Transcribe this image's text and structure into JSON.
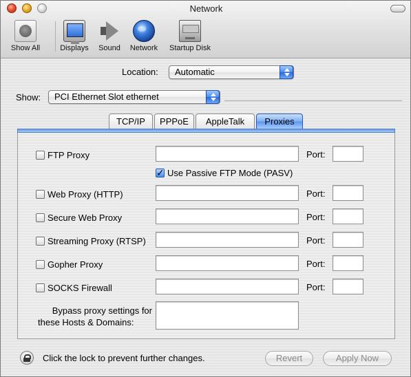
{
  "window": {
    "title": "Network"
  },
  "toolbar": {
    "show_all": "Show All",
    "items": [
      {
        "label": "Displays",
        "icon": "displays-icon"
      },
      {
        "label": "Sound",
        "icon": "speaker-icon"
      },
      {
        "label": "Network",
        "icon": "globe-icon"
      },
      {
        "label": "Startup Disk",
        "icon": "hard-disk-icon"
      }
    ]
  },
  "location": {
    "label": "Location:",
    "value": "Automatic"
  },
  "show": {
    "label": "Show:",
    "value": "PCI Ethernet Slot ethernet"
  },
  "tabs": [
    {
      "label": "TCP/IP",
      "active": false
    },
    {
      "label": "PPPoE",
      "active": false
    },
    {
      "label": "AppleTalk",
      "active": false
    },
    {
      "label": "Proxies",
      "active": true
    }
  ],
  "proxies": {
    "port_label": "Port:",
    "ftp": {
      "label": "FTP Proxy",
      "checked": false,
      "server": "",
      "port": ""
    },
    "passive_ftp": {
      "label": "Use Passive FTP Mode (PASV)",
      "checked": true
    },
    "web": {
      "label": "Web Proxy (HTTP)",
      "checked": false,
      "server": "",
      "port": ""
    },
    "secure_web": {
      "label": "Secure Web Proxy",
      "checked": false,
      "server": "",
      "port": ""
    },
    "streaming": {
      "label": "Streaming Proxy (RTSP)",
      "checked": false,
      "server": "",
      "port": ""
    },
    "gopher": {
      "label": "Gopher Proxy",
      "checked": false,
      "server": "",
      "port": ""
    },
    "socks": {
      "label": "SOCKS Firewall",
      "checked": false,
      "server": "",
      "port": ""
    },
    "bypass": {
      "label_line1": "Bypass proxy settings for",
      "label_line2": "these Hosts & Domains:",
      "value": ""
    }
  },
  "footer": {
    "lock_text": "Click the lock to prevent further changes.",
    "revert": "Revert",
    "apply": "Apply Now"
  },
  "colors": {
    "accent": "#4a8cf0",
    "tab_active": "#7fb0f4",
    "disabled_text": "#8a8a8a"
  }
}
